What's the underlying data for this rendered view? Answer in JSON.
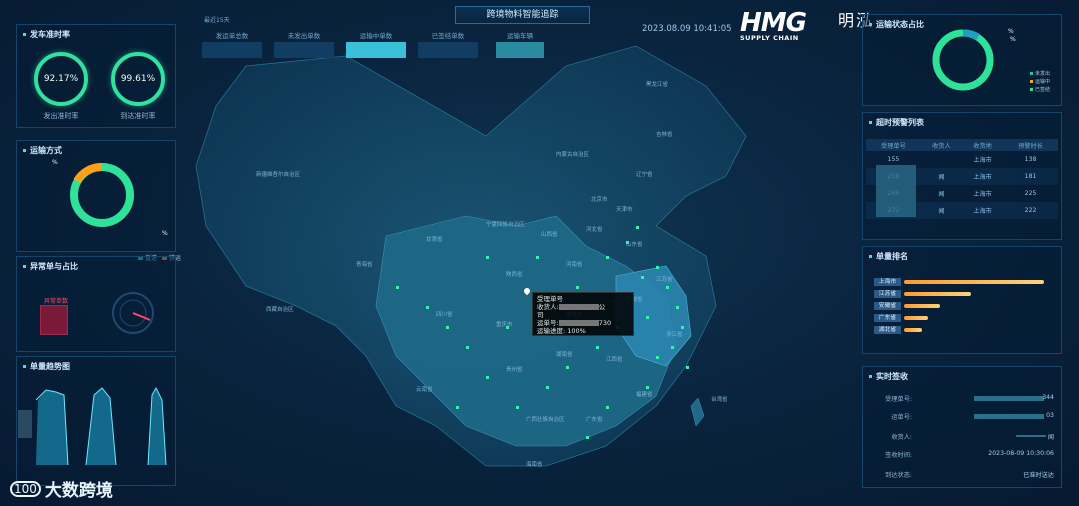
{
  "header": {
    "title": "跨境物料智能追踪",
    "datetime": "2023.08.09 10:41:05",
    "since_label": "最近15天",
    "top_tabs": [
      {
        "label": "发运单总数"
      },
      {
        "label": "未发出单数"
      },
      {
        "label": "运输中单数"
      },
      {
        "label": "已签结单数"
      },
      {
        "label": "运输车辆"
      }
    ]
  },
  "logo": {
    "main": "HMG",
    "sub": "SUPPLY CHAIN",
    "cn": "泓明"
  },
  "left": {
    "ontime": {
      "title": "发车准时率",
      "gauges": [
        {
          "value": "92.17%",
          "label": "发出准时率"
        },
        {
          "value": "99.61%",
          "label": "到达准时率"
        }
      ]
    },
    "transport": {
      "title": "运输方式",
      "pct_top": "%",
      "pct_bottom": "%",
      "legend": [
        {
          "label": "直送",
          "color": "#2fe29a"
        },
        {
          "label": "铁运",
          "color": "#ff9f1a"
        }
      ],
      "shares": [
        0.85,
        0.15
      ]
    },
    "abnormal": {
      "title": "异常单与占比",
      "bar_label": "异常单数"
    },
    "trend": {
      "title": "单量趋势图"
    }
  },
  "right": {
    "status": {
      "title": "运输状态占比",
      "pct_a": "%",
      "pct_b": "%",
      "legend": [
        {
          "label": "未发出",
          "color": "#20c6a0"
        },
        {
          "label": "运输中",
          "color": "#e6b22a"
        },
        {
          "label": "已签结",
          "color": "#2fe29a"
        }
      ]
    },
    "warning": {
      "title": "超时预警列表",
      "headers": [
        "受理单号",
        "收货人",
        "收货地",
        "预警时长"
      ],
      "rows": [
        [
          "155",
          "",
          "上海市",
          "138"
        ],
        [
          "259",
          "闻",
          "上海市",
          "181"
        ],
        [
          "269",
          "闻",
          "上海市",
          "225"
        ],
        [
          "272",
          "闻",
          "上海市",
          "222"
        ]
      ]
    },
    "ranking": {
      "title": "单量排名",
      "items": [
        {
          "name": "上海市",
          "share": 1.0
        },
        {
          "name": "江苏省",
          "share": 0.48
        },
        {
          "name": "安徽省",
          "share": 0.26
        },
        {
          "name": "广东省",
          "share": 0.17
        },
        {
          "name": "湖北省",
          "share": 0.13
        }
      ]
    },
    "realtime": {
      "title": "实时签收",
      "rows": [
        {
          "key": "受理单号:",
          "value": "344"
        },
        {
          "key": "运单号:",
          "value": "03"
        },
        {
          "key": "收货人:",
          "value": "闻"
        },
        {
          "key": "签收时间:",
          "value": "2023-08-09 10:30:06"
        },
        {
          "key": "到达状态:",
          "value": "已准时送达"
        }
      ]
    }
  },
  "tooltip": {
    "line1": "受理单号",
    "line2_prefix": "收货人:",
    "line2_suffix": "公",
    "line3": "司",
    "line4_prefix": "运单号:",
    "line4_suffix": "730",
    "line5": "运输进度: 100%"
  },
  "map": {
    "labels": [
      "黑龙江省",
      "吉林省",
      "辽宁省",
      "内蒙古自治区",
      "北京市",
      "天津市",
      "河北省",
      "山西省",
      "山东省",
      "宁夏回族自治区",
      "甘肃省",
      "青海省",
      "陕西省",
      "河南省",
      "江苏省",
      "安徽省",
      "湖北省",
      "重庆市",
      "四川省",
      "湖南省",
      "江西省",
      "浙江省",
      "贵州省",
      "云南省",
      "福建省",
      "广西壮族自治区",
      "广东省",
      "海南省",
      "新疆维吾尔自治区",
      "西藏自治区",
      "台湾省"
    ]
  },
  "watermark": {
    "icon": "100",
    "text": "大数跨境"
  }
}
